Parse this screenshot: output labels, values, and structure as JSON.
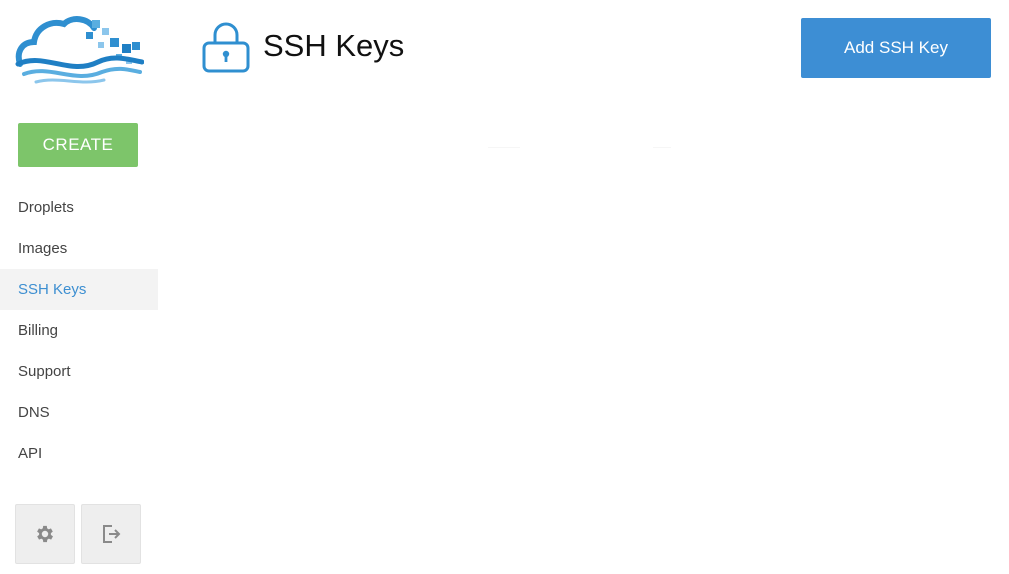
{
  "sidebar": {
    "create_label": "CREATE",
    "items": [
      {
        "label": "Droplets",
        "active": false
      },
      {
        "label": "Images",
        "active": false
      },
      {
        "label": "SSH Keys",
        "active": true
      },
      {
        "label": "Billing",
        "active": false
      },
      {
        "label": "Support",
        "active": false
      },
      {
        "label": "DNS",
        "active": false
      },
      {
        "label": "API",
        "active": false
      }
    ],
    "footer": {
      "settings_icon": "gear-icon",
      "logout_icon": "logout-icon"
    }
  },
  "header": {
    "title": "SSH Keys",
    "icon": "lock-icon",
    "add_button_label": "Add SSH Key"
  },
  "colors": {
    "brand_blue": "#3d8ed4",
    "create_green": "#7dc56a",
    "active_nav_text": "#3d8fd1",
    "active_nav_bg": "#f3f3f3"
  }
}
